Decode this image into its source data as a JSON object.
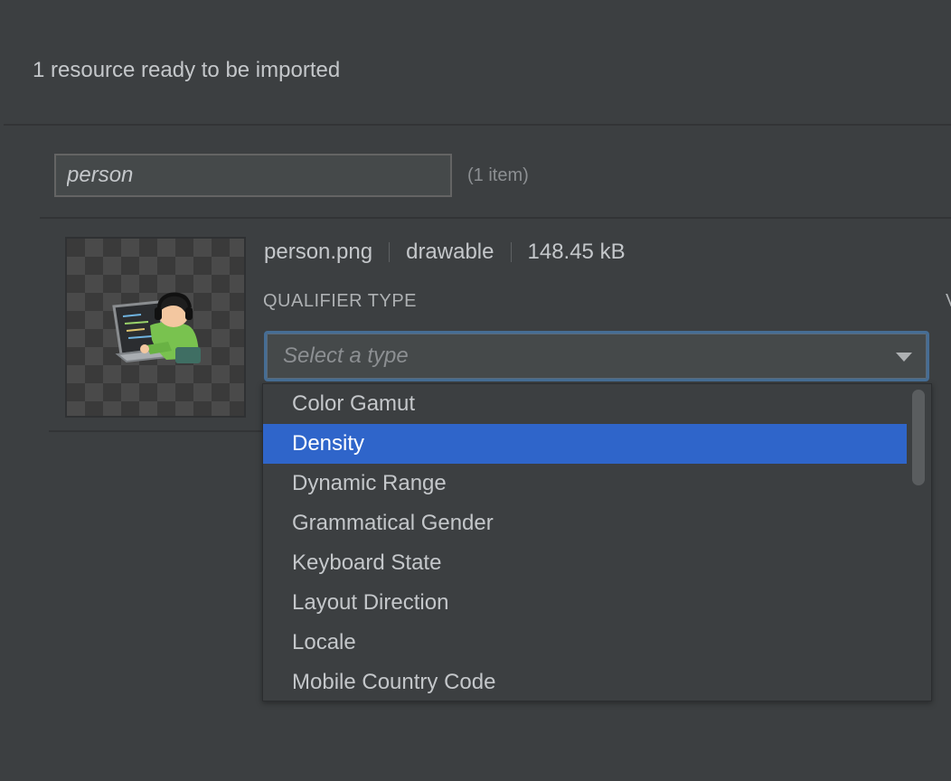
{
  "header": {
    "title": "1 resource ready to be imported"
  },
  "search": {
    "value": "person",
    "count_label": "(1 item)"
  },
  "resource": {
    "file_name": "person.png",
    "type": "drawable",
    "size": "148.45 kB",
    "thumbnail_icon": "person-at-laptop-image"
  },
  "qualifier": {
    "label": "QUALIFIER TYPE",
    "cutoff_label": "V",
    "placeholder": "Select a type",
    "options": [
      {
        "label": "Color Gamut",
        "selected": false
      },
      {
        "label": "Density",
        "selected": true
      },
      {
        "label": "Dynamic Range",
        "selected": false
      },
      {
        "label": "Grammatical Gender",
        "selected": false
      },
      {
        "label": "Keyboard State",
        "selected": false
      },
      {
        "label": "Layout Direction",
        "selected": false
      },
      {
        "label": "Locale",
        "selected": false
      },
      {
        "label": "Mobile Country Code",
        "selected": false
      }
    ]
  },
  "colors": {
    "background": "#3c3f41",
    "selection": "#2f65ca",
    "focus_border": "#466d94",
    "text": "#c4c7ca"
  }
}
